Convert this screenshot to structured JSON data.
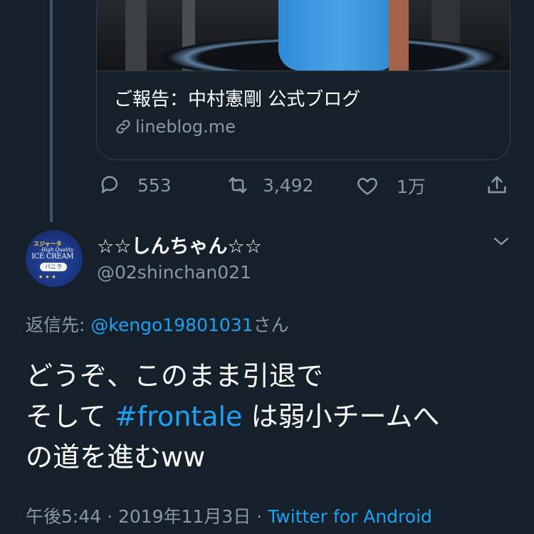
{
  "card": {
    "title": "ご報告：中村憲剛 公式ブログ",
    "domain": "lineblog.me"
  },
  "actions": {
    "reply_count": "553",
    "retweet_count": "3,492",
    "like_count": "1万"
  },
  "reply": {
    "display_name": "☆☆しんちゃん☆☆",
    "handle": "@02shinchan021",
    "avatar": {
      "brand": "スジャータ",
      "subtitle": "High Quality",
      "title": "ICE CREAM",
      "flavor": "バニラ"
    },
    "reply_to_prefix": "返信先: ",
    "reply_to_mention": "@kengo19801031",
    "reply_to_suffix": "さん",
    "text_line1": "どうぞ、このまま引退で",
    "text_line2_a": "そして ",
    "hashtag": "#frontale",
    "text_line2_b": " は弱小チームへ",
    "text_line3": "の道を進むww",
    "time": "午後5:44",
    "sep1": " · ",
    "date": "2019年11月3日",
    "sep2": " · ",
    "source": "Twitter for Android"
  },
  "colors": {
    "background": "#15202b",
    "secondary_text": "#8899a6",
    "link": "#1da1f2",
    "border": "#38444d"
  },
  "icons": [
    "link-icon",
    "reply-icon",
    "retweet-icon",
    "like-icon",
    "share-icon",
    "chevron-down-icon"
  ]
}
